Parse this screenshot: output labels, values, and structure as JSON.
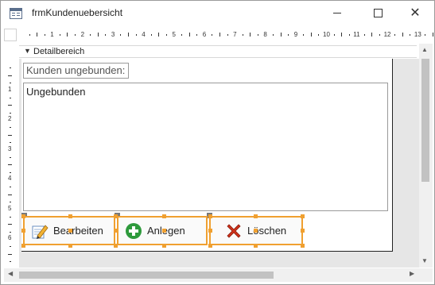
{
  "window": {
    "title": "frmKundenuebersicht"
  },
  "ruler": {
    "top_numbers": [
      "1",
      "2",
      "3",
      "4",
      "5",
      "6",
      "7",
      "8",
      "9",
      "10",
      "11",
      "12",
      "13"
    ],
    "left_numbers": [
      "1",
      "2",
      "3",
      "4",
      "5",
      "6"
    ]
  },
  "section": {
    "label": "Detailbereich"
  },
  "form": {
    "label_text": "Kunden ungebunden:",
    "listbox_text": "Ungebunden"
  },
  "buttons": [
    {
      "label": "Bearbeiten",
      "icon": "pencil-icon"
    },
    {
      "label": "Anlegen",
      "icon": "plus-circle-icon"
    },
    {
      "label": "Löschen",
      "icon": "red-x-icon"
    }
  ],
  "colors": {
    "selection_handle": "#f0a030",
    "design_background": "#e6e6e6",
    "anlegen_icon": "#2e9a3c",
    "loeschen_icon": "#d0331c"
  }
}
